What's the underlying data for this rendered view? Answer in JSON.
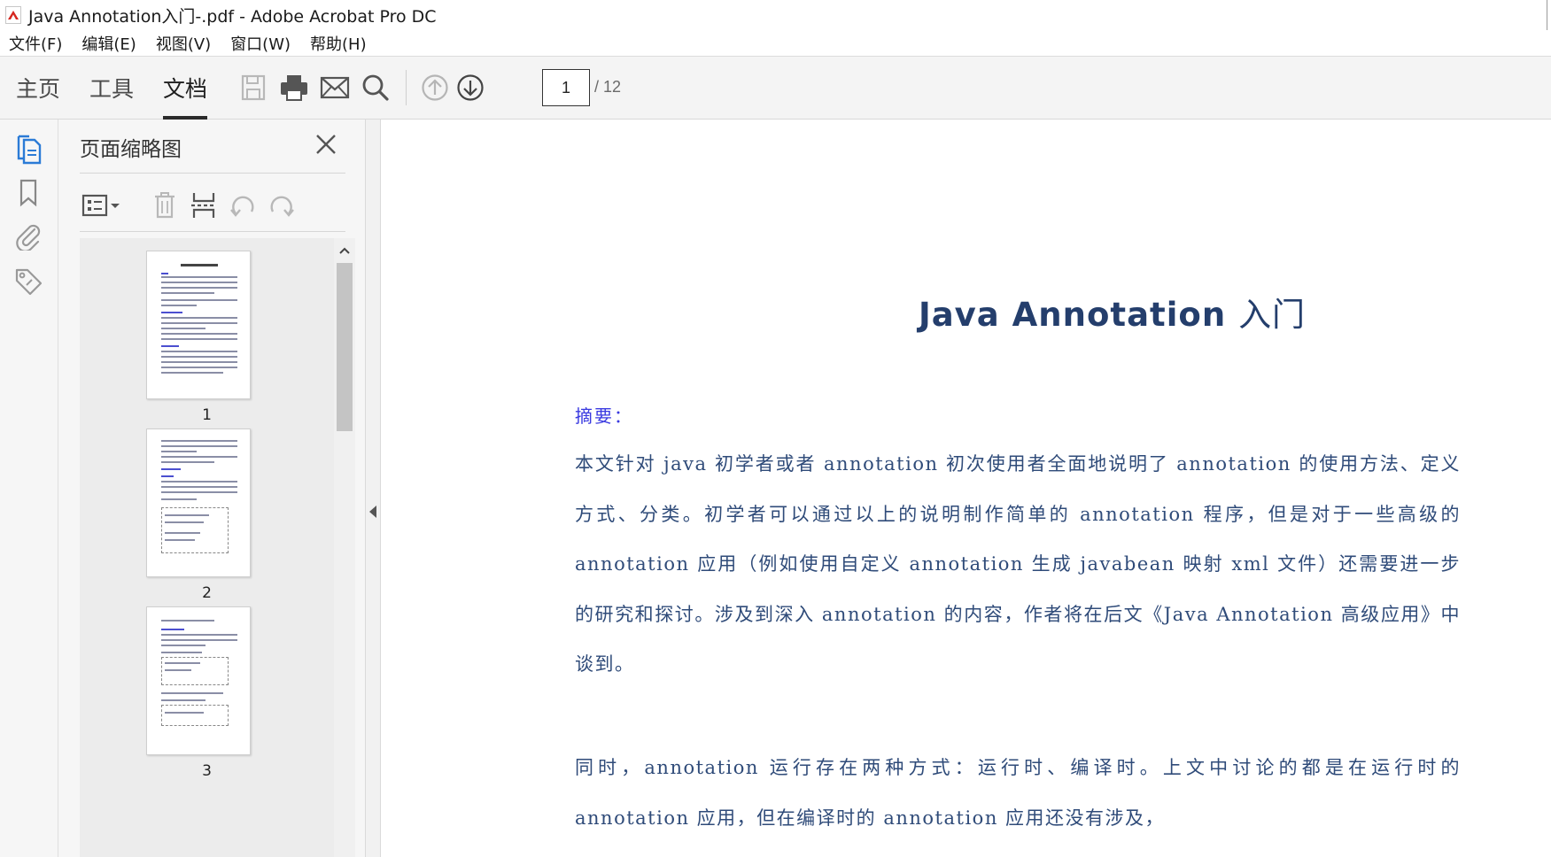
{
  "window": {
    "title": "Java Annotation入门-.pdf - Adobe Acrobat Pro DC"
  },
  "menu": {
    "items": [
      "文件(F)",
      "编辑(E)",
      "视图(V)",
      "窗口(W)",
      "帮助(H)"
    ]
  },
  "toolbar": {
    "tabs": [
      "主页",
      "工具",
      "文档"
    ],
    "active_tab": "文档",
    "current_page": "1",
    "total_pages": "/ 12",
    "icons": [
      "save-icon",
      "print-icon",
      "email-icon",
      "search-icon",
      "page-up-icon",
      "page-down-icon"
    ]
  },
  "left_rail": {
    "icons": [
      "page-thumbnails-icon",
      "bookmark-icon",
      "attachment-icon",
      "tag-icon"
    ]
  },
  "thumbnails_panel": {
    "title": "页面缩略图",
    "tool_icons": [
      "options-icon",
      "delete-icon",
      "insert-pages-icon",
      "rotate-left-icon",
      "rotate-right-icon"
    ],
    "pages": [
      "1",
      "2",
      "3"
    ]
  },
  "document": {
    "title": "Java  Annotation",
    "title_cn": "入门",
    "abstract_label": "摘要：",
    "paragraph1": "本文针对 java 初学者或者 annotation 初次使用者全面地说明了 annotation 的使用方法、定义方式、分类。初学者可以通过以上的说明制作简单的 annotation 程序，但是对于一些高级的 annotation 应用（例如使用自定义 annotation 生成 javabean 映射 xml 文件）还需要进一步的研究和探讨。涉及到深入 annotation 的内容，作者将在后文《Java  Annotation 高级应用》中谈到。",
    "paragraph2": "同时，annotation 运行存在两种方式：运行时、编译时。上文中讨论的都是在运行时的 annotation 应用，但在编译时的 annotation 应用还没有涉及，"
  },
  "colors": {
    "title": "#243e6c",
    "body_text": "#2f4b79",
    "abstract_label": "#3a3ae0",
    "toolbar_bg": "#f4f4f4",
    "panel_bg": "#f6f6f6"
  }
}
